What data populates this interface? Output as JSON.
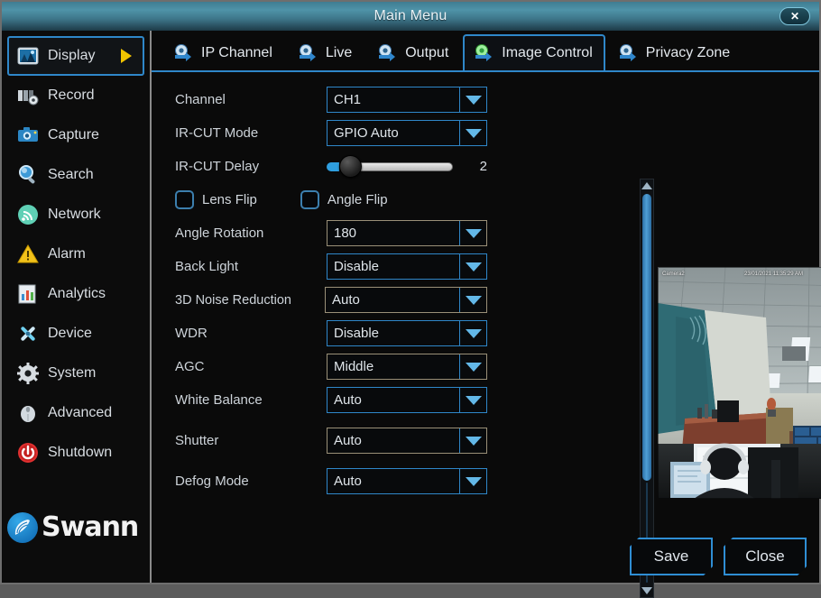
{
  "window": {
    "title": "Main Menu",
    "close_icon": "close-icon",
    "close_label": "✕"
  },
  "sidebar": {
    "items": [
      {
        "label": "Display",
        "icon": "display-icon",
        "active": true
      },
      {
        "label": "Record",
        "icon": "record-icon",
        "active": false
      },
      {
        "label": "Capture",
        "icon": "capture-icon",
        "active": false
      },
      {
        "label": "Search",
        "icon": "search-icon",
        "active": false
      },
      {
        "label": "Network",
        "icon": "network-icon",
        "active": false
      },
      {
        "label": "Alarm",
        "icon": "alarm-icon",
        "active": false
      },
      {
        "label": "Analytics",
        "icon": "analytics-icon",
        "active": false
      },
      {
        "label": "Device",
        "icon": "device-icon",
        "active": false
      },
      {
        "label": "System",
        "icon": "system-icon",
        "active": false
      },
      {
        "label": "Advanced",
        "icon": "advanced-icon",
        "active": false
      },
      {
        "label": "Shutdown",
        "icon": "shutdown-icon",
        "active": false
      }
    ],
    "brand": "Swann"
  },
  "tabs": [
    {
      "label": "IP Channel",
      "active": false
    },
    {
      "label": "Live",
      "active": false
    },
    {
      "label": "Output",
      "active": false
    },
    {
      "label": "Image Control",
      "active": true
    },
    {
      "label": "Privacy Zone",
      "active": false
    }
  ],
  "form": {
    "channel": {
      "label": "Channel",
      "value": "CH1"
    },
    "ircut_mode": {
      "label": "IR-CUT Mode",
      "value": "GPIO Auto"
    },
    "ircut_delay": {
      "label": "IR-CUT Delay",
      "value": "2"
    },
    "lens_flip": {
      "label": "Lens Flip",
      "checked": false
    },
    "angle_flip": {
      "label": "Angle Flip",
      "checked": false
    },
    "angle_rotation": {
      "label": "Angle Rotation",
      "value": "180"
    },
    "back_light": {
      "label": "Back Light",
      "value": "Disable"
    },
    "noise_reduction": {
      "label": "3D Noise Reduction",
      "value": "Auto"
    },
    "wdr": {
      "label": "WDR",
      "value": "Disable"
    },
    "agc": {
      "label": "AGC",
      "value": "Middle"
    },
    "white_balance": {
      "label": "White Balance",
      "value": "Auto"
    },
    "shutter": {
      "label": "Shutter",
      "value": "Auto"
    },
    "defog_mode": {
      "label": "Defog Mode",
      "value": "Auto"
    }
  },
  "preview": {
    "camera_name": "Camera2",
    "timestamp": "23/01/2021 11:35:29 AM"
  },
  "footer": {
    "save_label": "Save",
    "close_label": "Close"
  },
  "colors": {
    "accent_blue": "#2f87c9",
    "arrow_yellow": "#f2c400",
    "active_tab_green": "#4fd14f",
    "title_teal": "#4f93a8"
  }
}
